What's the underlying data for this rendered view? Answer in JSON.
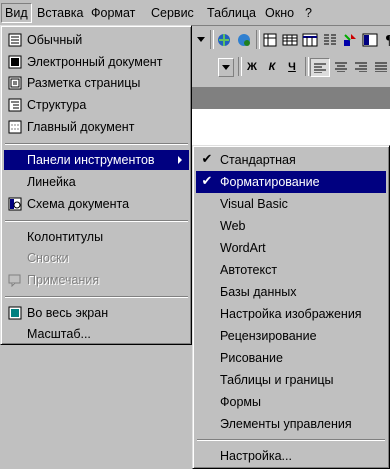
{
  "menubar": {
    "items": [
      "Вид",
      "Вставка",
      "Формат",
      "Сервис",
      "Таблица",
      "Окно",
      "?"
    ]
  },
  "view_menu": {
    "items": [
      {
        "label": "Обычный",
        "icon": "normal-view-icon"
      },
      {
        "label": "Электронный документ",
        "icon": "web-layout-icon"
      },
      {
        "label": "Разметка страницы",
        "icon": "page-layout-icon"
      },
      {
        "label": "Структура",
        "icon": "outline-icon"
      },
      {
        "label": "Главный документ",
        "icon": "master-document-icon"
      },
      {
        "label": "Панели инструментов",
        "submenu": true
      },
      {
        "label": "Линейка"
      },
      {
        "label": "Схема документа",
        "icon": "document-map-icon"
      },
      {
        "label": "Колонтитулы"
      },
      {
        "label": "Сноски",
        "disabled": true
      },
      {
        "label": "Примечания",
        "disabled": true,
        "icon": "comments-icon"
      },
      {
        "label": "Во весь экран",
        "icon": "full-screen-icon"
      },
      {
        "label": "Масштаб..."
      }
    ]
  },
  "toolbars_submenu": {
    "items": [
      {
        "label": "Стандартная",
        "checked": true
      },
      {
        "label": "Форматирование",
        "checked": true
      },
      {
        "label": "Visual Basic"
      },
      {
        "label": "Web"
      },
      {
        "label": "WordArt"
      },
      {
        "label": "Автотекст"
      },
      {
        "label": "Базы данных"
      },
      {
        "label": "Настройка изображения"
      },
      {
        "label": "Рецензирование"
      },
      {
        "label": "Рисование"
      },
      {
        "label": "Таблицы и границы"
      },
      {
        "label": "Формы"
      },
      {
        "label": "Элементы управления"
      },
      {
        "label": "Настройка..."
      }
    ]
  },
  "format_toolbar": {
    "bold": "Ж",
    "italic": "К",
    "underline": "Ч"
  },
  "colors": {
    "highlight": "#000080",
    "face": "#c0c0c0"
  }
}
